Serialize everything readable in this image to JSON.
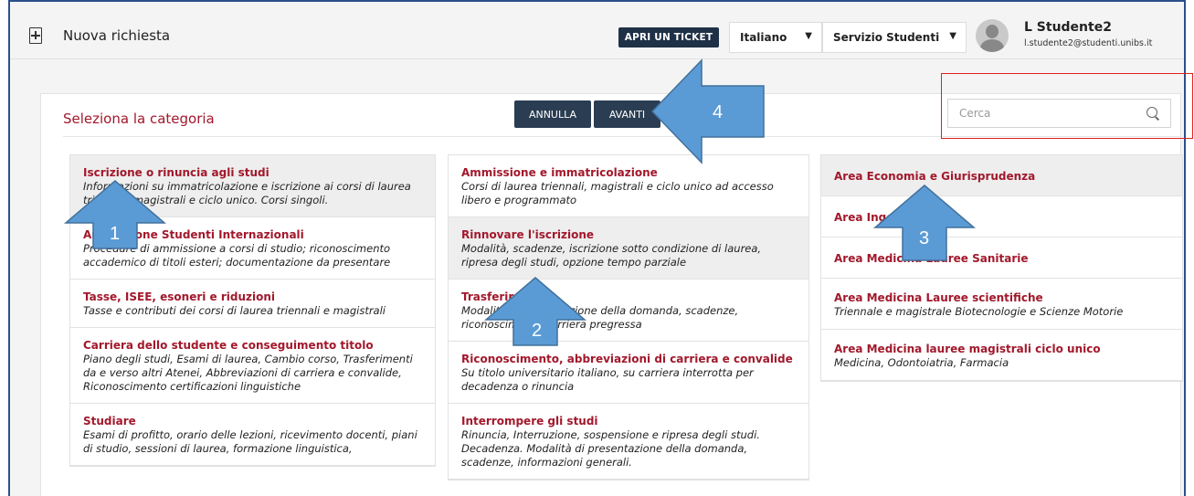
{
  "header": {
    "title": "Nuova richiesta",
    "ticket_label": "APRI UN TICKET",
    "language": "Italiano",
    "service": "Servizio Studenti",
    "user_name": "L Studente2",
    "user_email": "l.studente2@studenti.unibs.it"
  },
  "panel": {
    "title": "Seleziona la categoria",
    "cancel_label": "ANNULLA",
    "next_label": "AVANTI",
    "search_placeholder": "Cerca"
  },
  "columns": {
    "left": [
      {
        "title": "Iscrizione o rinuncia agli studi",
        "desc": "Informazioni su immatricolazione e iscrizione ai corsi di laurea triennali, magistrali e ciclo unico. Corsi singoli."
      },
      {
        "title": "Ammissione Studenti Internazionali",
        "desc": "Procedure di ammissione a corsi di studio; riconoscimento accademico di titoli esteri; documentazione da presentare"
      },
      {
        "title": "Tasse, ISEE, esoneri e riduzioni",
        "desc": "Tasse e contributi dei corsi di laurea triennali e magistrali"
      },
      {
        "title": "Carriera dello studente e conseguimento titolo",
        "desc": "Piano degli studi, Esami di laurea, Cambio corso, Trasferimenti da e verso altri Atenei, Abbreviazioni di carriera e convalide, Riconoscimento certificazioni linguistiche"
      },
      {
        "title": "Studiare",
        "desc": "Esami di profitto, orario delle lezioni, ricevimento docenti, piani di studio, sessioni di laurea, formazione linguistica,"
      }
    ],
    "middle": [
      {
        "title": "Ammissione e immatricolazione",
        "desc": "Corsi di laurea triennali, magistrali e ciclo unico ad accesso libero e programmato"
      },
      {
        "title": "Rinnovare l'iscrizione",
        "desc": "Modalità, scadenze, iscrizione sotto condizione di laurea, ripresa degli studi, opzione tempo parziale"
      },
      {
        "title": "Trasferirsi",
        "desc": "Modalità di presentazione della domanda, scadenze, riconoscimento carriera pregressa"
      },
      {
        "title": "Riconoscimento, abbreviazioni di carriera e convalide",
        "desc": "Su titolo universitario italiano, su carriera interrotta per decadenza o rinuncia"
      },
      {
        "title": "Interrompere gli studi",
        "desc": "Rinuncia, Interruzione, sospensione e ripresa degli studi. Decadenza. Modalità di presentazione della domanda, scadenze, informazioni generali."
      }
    ],
    "right": [
      {
        "title": "Area Economia e Giurisprudenza",
        "desc": ""
      },
      {
        "title": "Area Ingegneria",
        "desc": ""
      },
      {
        "title": "Area Medicina Lauree Sanitarie",
        "desc": ""
      },
      {
        "title": "Area Medicina Lauree scientifiche",
        "desc": "Triennale e magistrale Biotecnologie e Scienze Motorie"
      },
      {
        "title": "Area Medicina lauree magistrali ciclo unico",
        "desc": "Medicina, Odontoiatria, Farmacia"
      }
    ]
  },
  "annotations": {
    "arrow_1": "1",
    "arrow_2": "2",
    "arrow_3": "3",
    "arrow_4": "4"
  },
  "colors": {
    "accent": "#a2182b",
    "dark_button": "#2a3d52",
    "arrow_fill": "#5b9bd5",
    "highlight_box": "#e02020"
  }
}
